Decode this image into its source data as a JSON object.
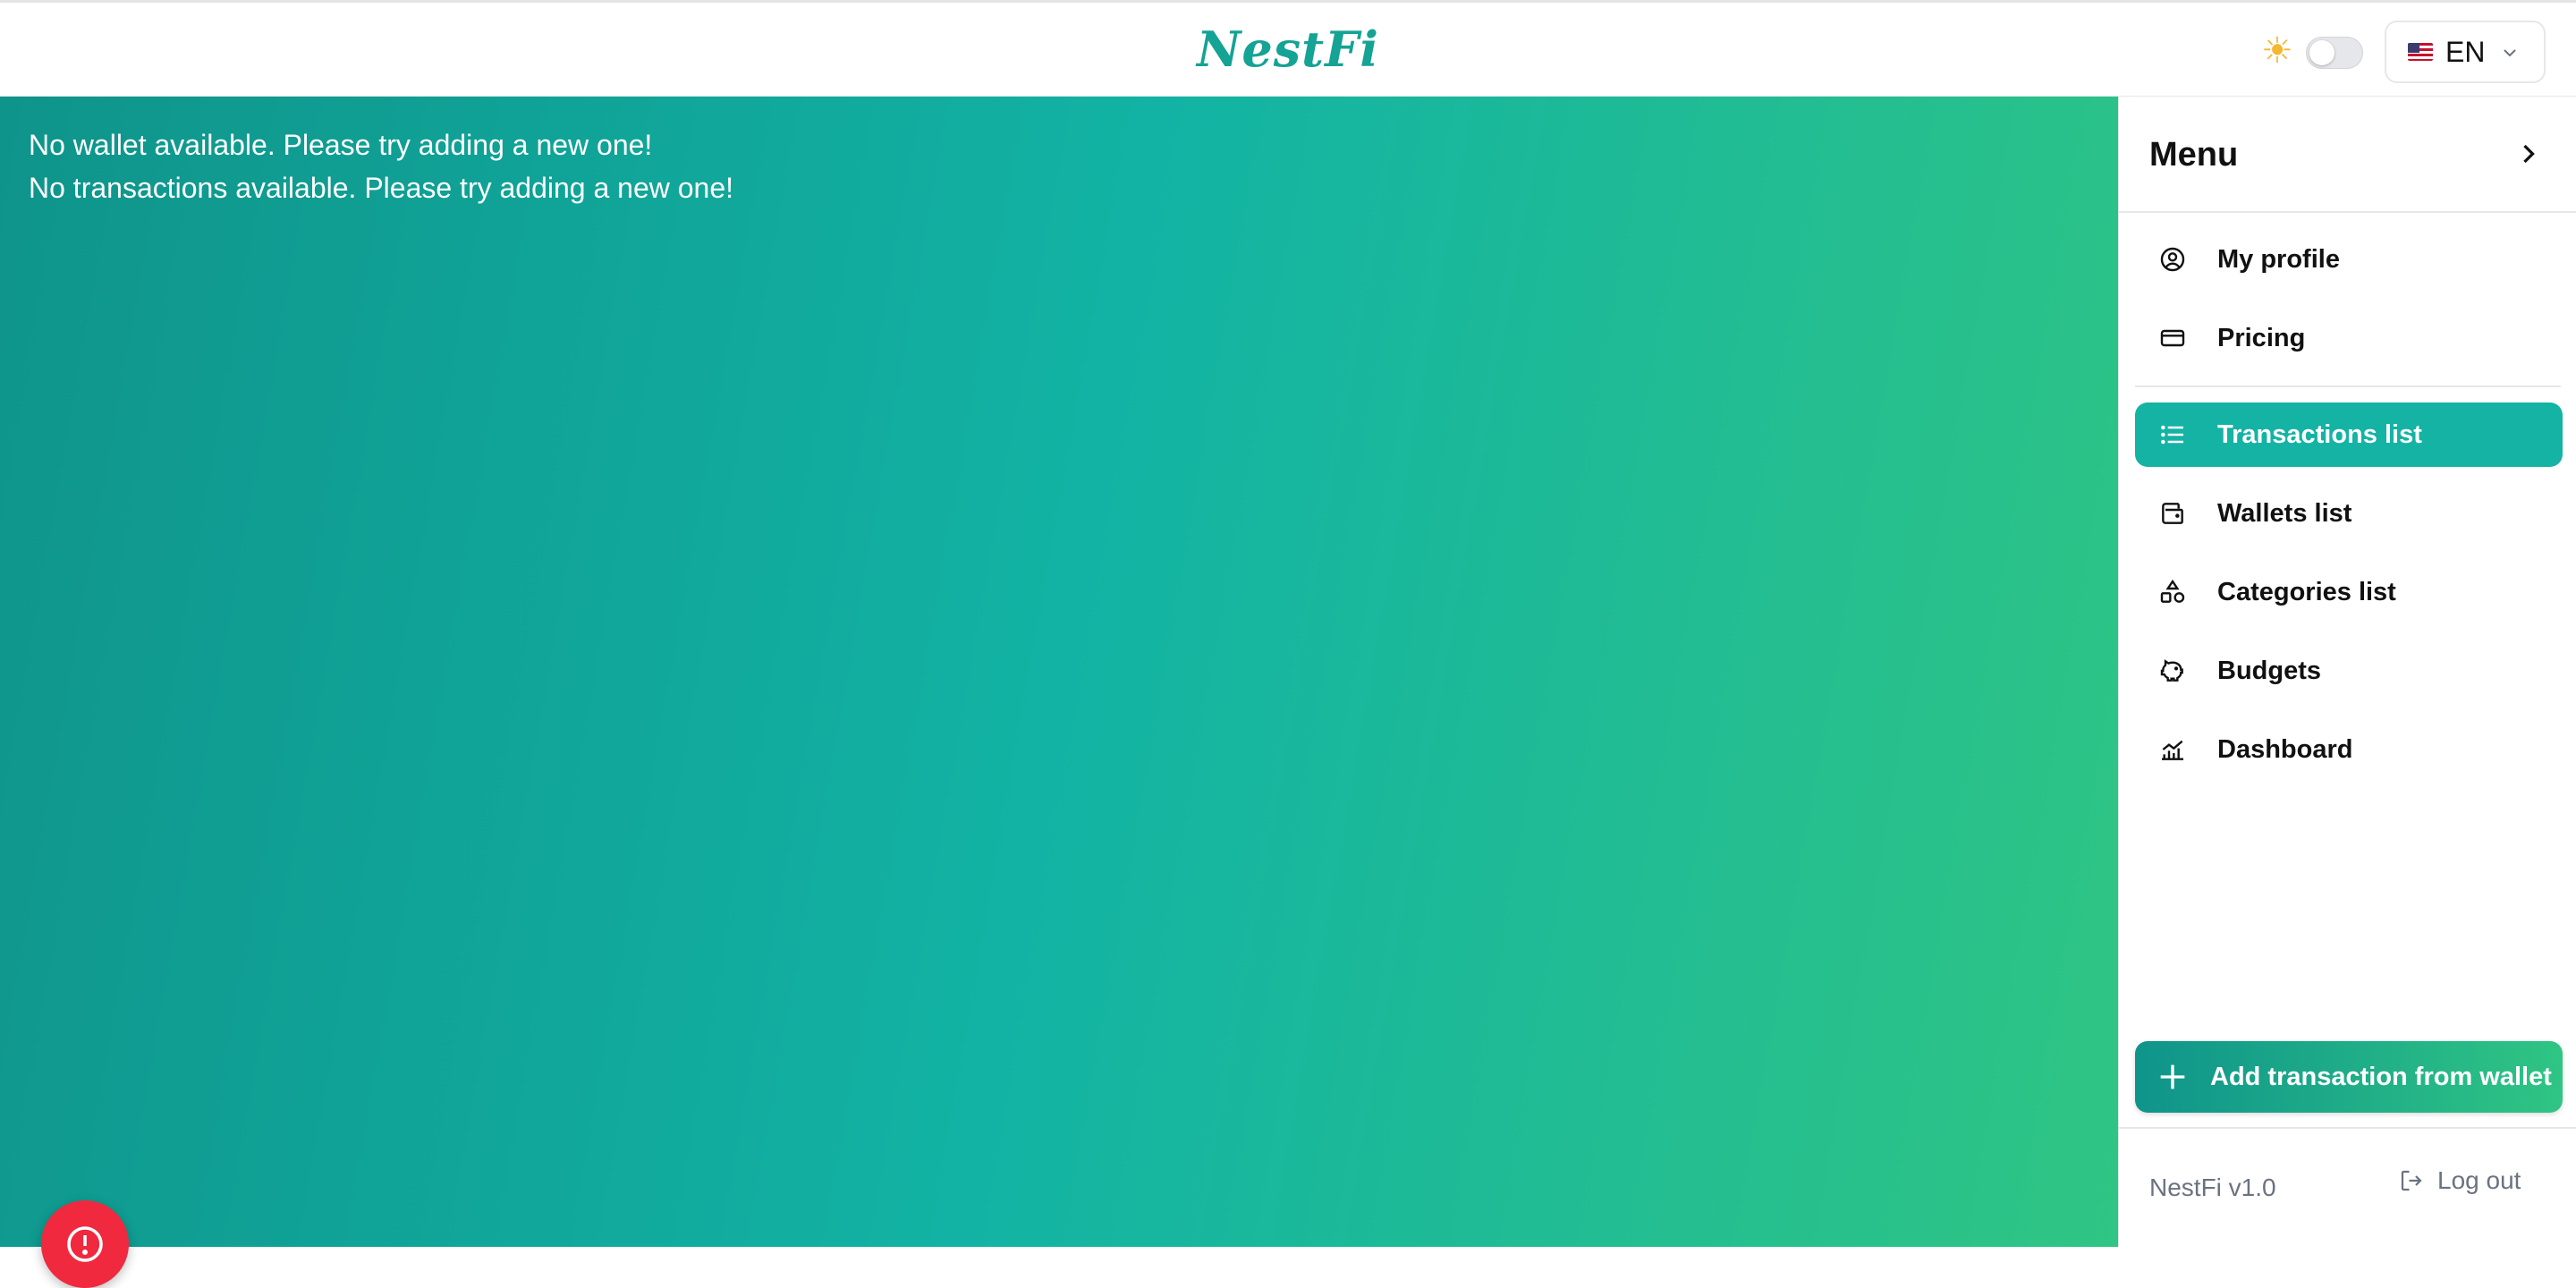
{
  "header": {
    "brand": "NestFi",
    "theme_icon": "sun-icon",
    "language": {
      "code": "EN",
      "flag": "us-flag-icon"
    }
  },
  "main": {
    "messages": [
      "No wallet available. Please try adding a new one!",
      "No transactions available. Please try adding a new one!"
    ]
  },
  "sidebar": {
    "title": "Menu",
    "items": [
      {
        "label": "My profile",
        "icon": "user-circle-icon"
      },
      {
        "label": "Pricing",
        "icon": "credit-card-icon"
      },
      {
        "label": "Transactions list",
        "icon": "list-icon",
        "active": true
      },
      {
        "label": "Wallets list",
        "icon": "wallet-icon"
      },
      {
        "label": "Categories list",
        "icon": "shapes-icon"
      },
      {
        "label": "Budgets",
        "icon": "piggy-bank-icon"
      },
      {
        "label": "Dashboard",
        "icon": "chart-icon"
      }
    ],
    "add_button": "Add transaction from wallet",
    "version": "NestFi v1.0",
    "logout": "Log out"
  },
  "colors": {
    "accent": "#14b3a4",
    "gradient_start": "#0f948b",
    "gradient_end": "#2fc584",
    "alert": "#f0293e"
  }
}
